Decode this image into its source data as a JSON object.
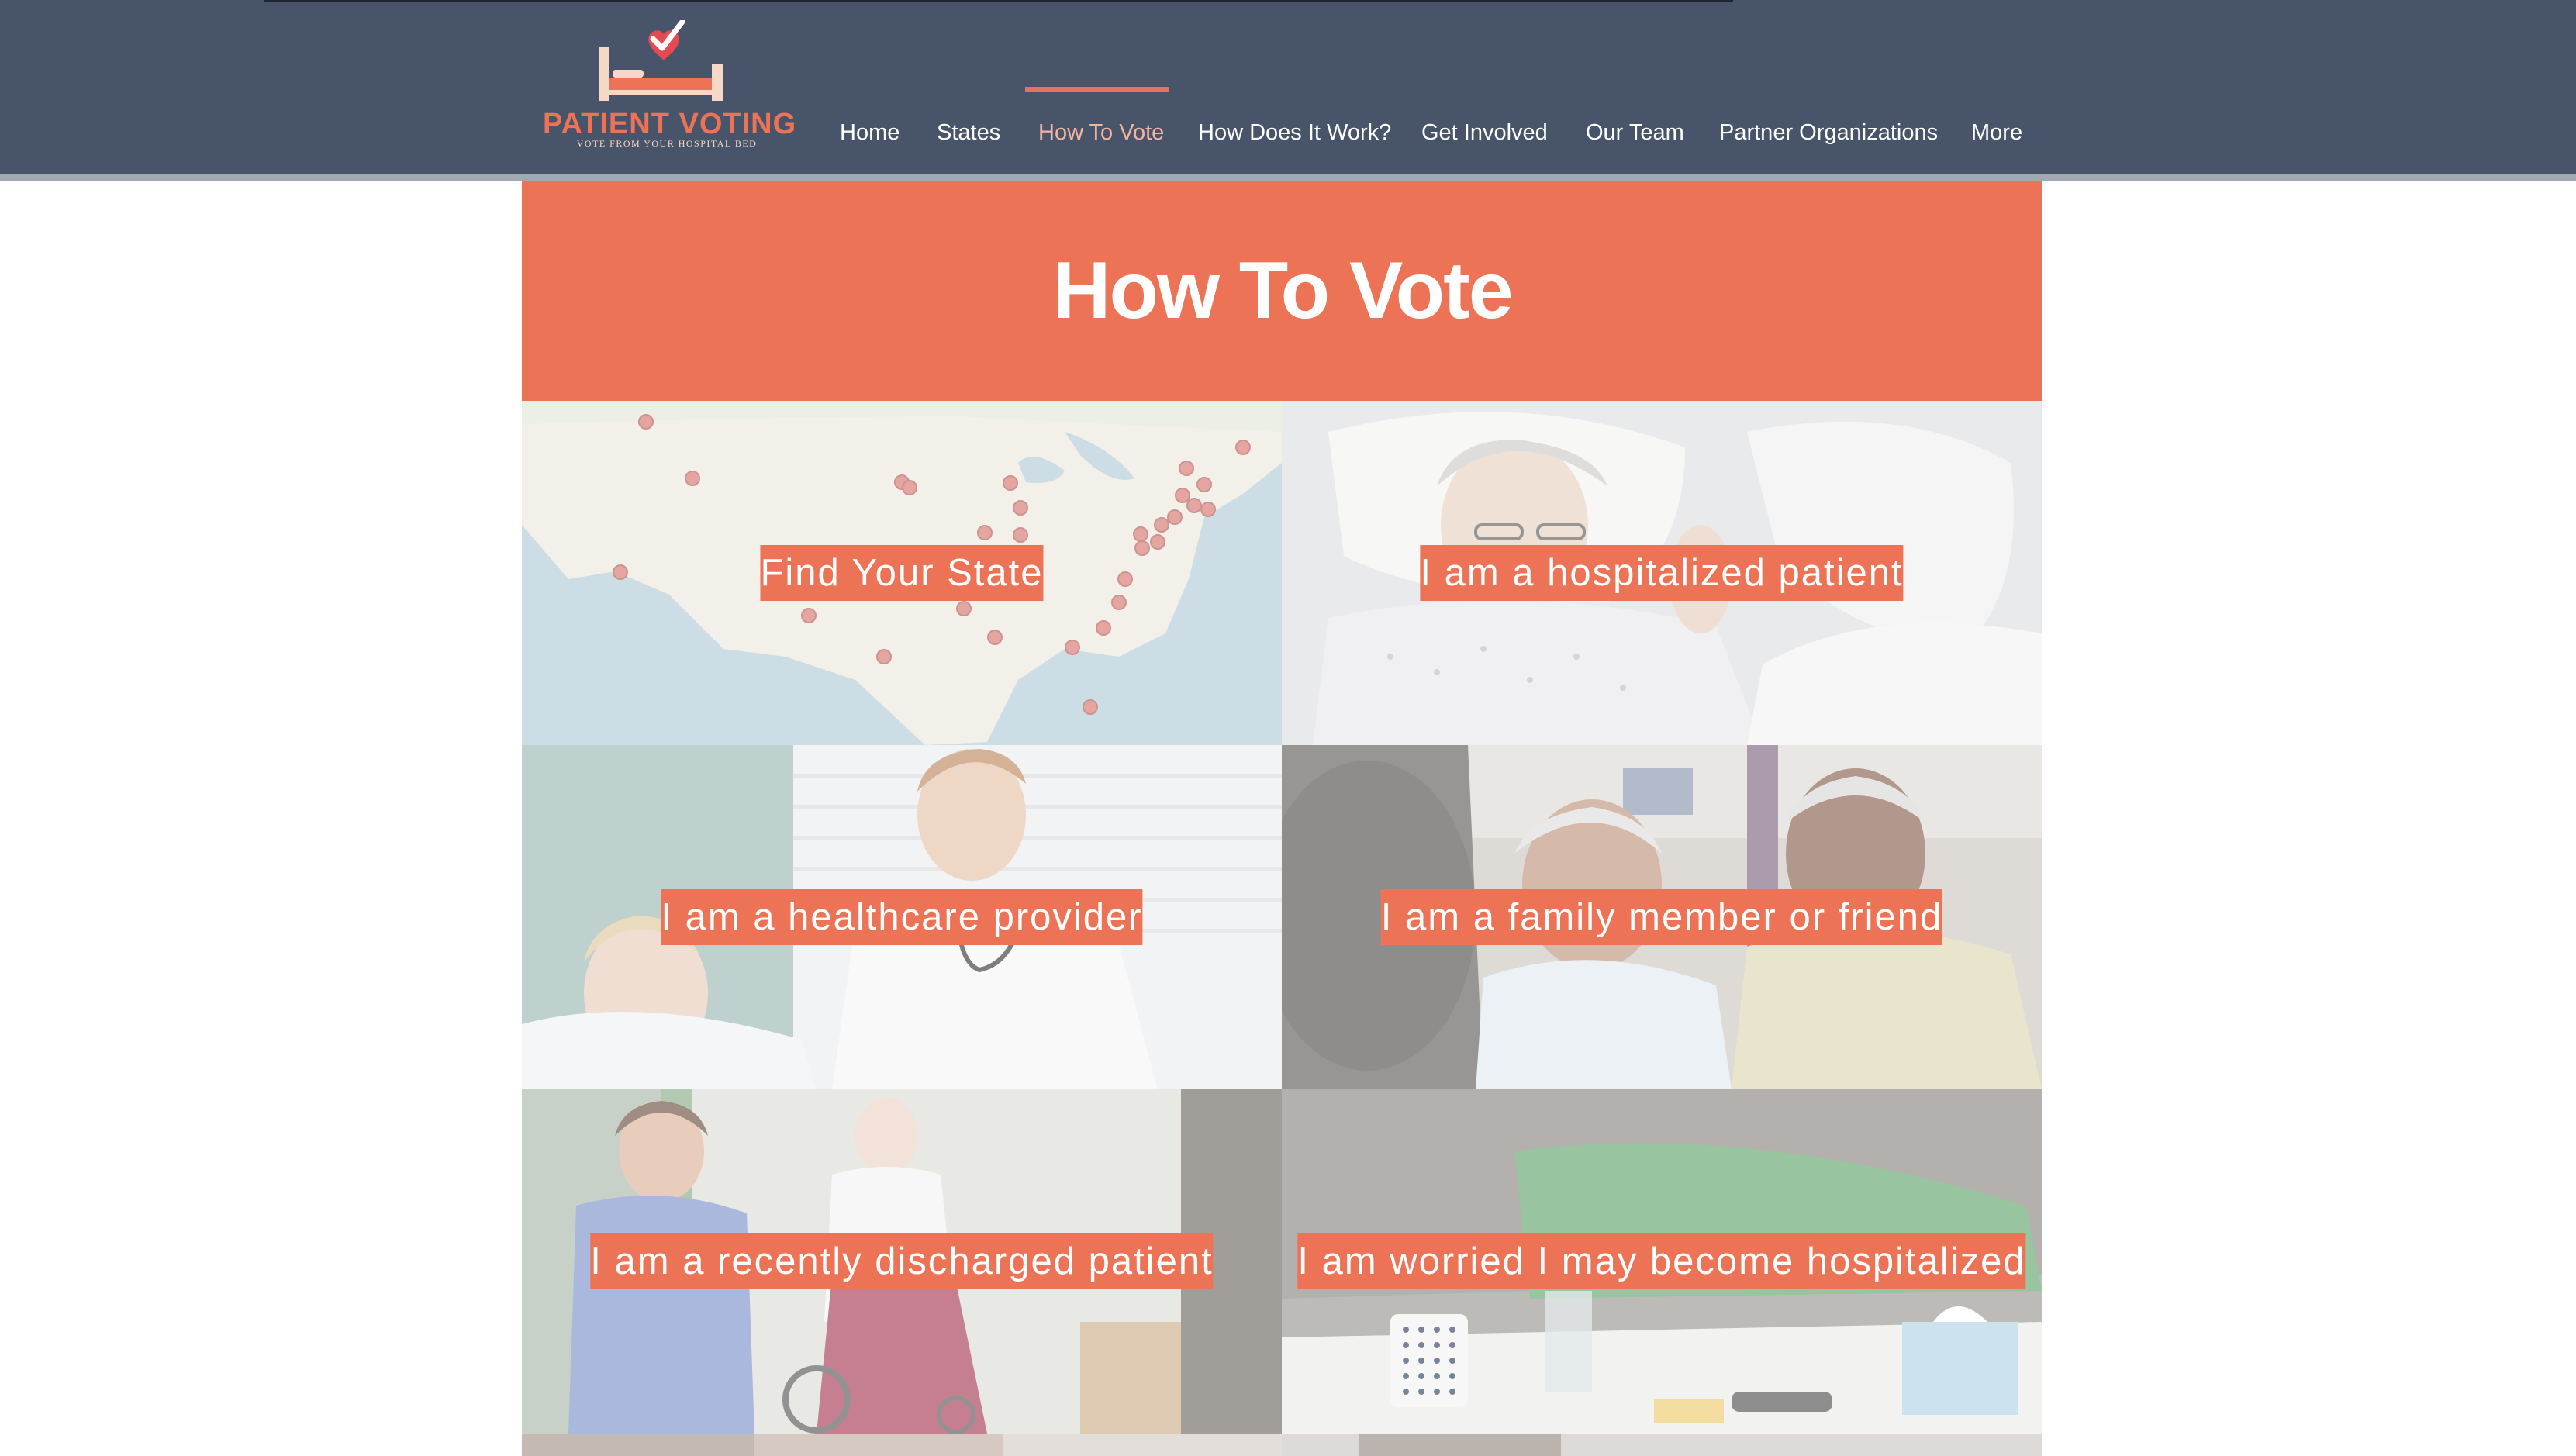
{
  "header": {
    "logo": {
      "title": "PATIENT VOTING",
      "tagline": "VOTE FROM YOUR HOSPITAL BED",
      "icon": "hospital-bed-checkmark-logo"
    },
    "nav": {
      "items": [
        {
          "label": "Home",
          "active": false
        },
        {
          "label": "States",
          "active": false
        },
        {
          "label": "How To Vote",
          "active": true
        },
        {
          "label": "How Does It Work?",
          "active": false
        },
        {
          "label": "Get Involved",
          "active": false
        },
        {
          "label": "Our Team",
          "active": false
        },
        {
          "label": "Partner Organizations",
          "active": false
        },
        {
          "label": "More",
          "active": false
        }
      ]
    }
  },
  "main": {
    "title": "How To Vote",
    "tiles": [
      {
        "label": "Find Your State",
        "image": "us-map-with-location-pins"
      },
      {
        "label": "I am a hospitalized patient",
        "image": "elderly-woman-in-hospital-bed"
      },
      {
        "label": "I am a healthcare provider",
        "image": "nurse-with-stethoscope-and-patient"
      },
      {
        "label": "I am a family member or friend",
        "image": "family-visiting-patient"
      },
      {
        "label": "I am a recently discharged patient",
        "image": "nurse-pushing-wheelchair"
      },
      {
        "label": "I am worried I may become hospitalized",
        "image": "bedside-table-with-mug-and-tissues"
      }
    ]
  },
  "colors": {
    "header_bg": "#485469",
    "accent": "#ec7356",
    "nav_active": "#f2b49f",
    "text_light": "#ffffff"
  }
}
